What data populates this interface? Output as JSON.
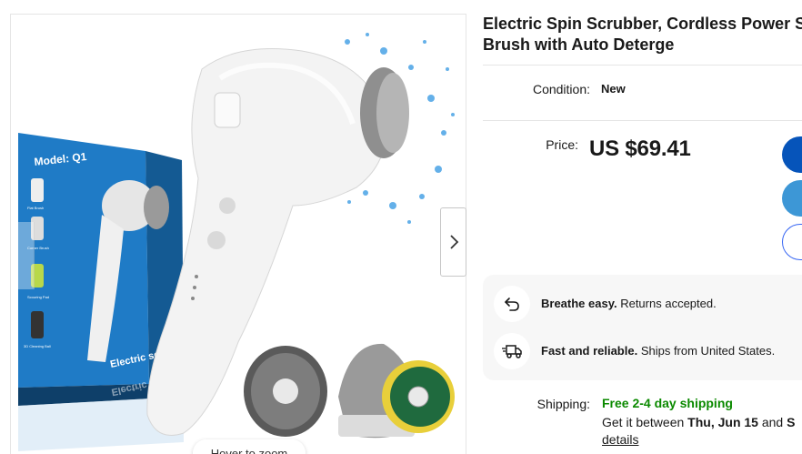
{
  "listing": {
    "title_line1": "Electric Spin Scrubber, Cordless Power S",
    "title_line2": "Brush with Auto Deterge"
  },
  "image": {
    "zoom_hint": "Hover to zoom",
    "box_model_text": "Model: Q1",
    "box_side_text": "Electric scrub",
    "box_side_reflection": "Electric scrub",
    "heads": [
      "Flat Brush",
      "Corner Brush",
      "Scouring Pad",
      "3D Cleaning Ball"
    ]
  },
  "condition": {
    "label": "Condition:",
    "value": "New"
  },
  "price": {
    "label": "Price:",
    "value": "US $69.41"
  },
  "assurances": [
    {
      "icon": "return-arrow-icon",
      "bold": "Breathe easy.",
      "text": " Returns accepted."
    },
    {
      "icon": "delivery-truck-icon",
      "bold": "Fast and reliable.",
      "text": " Ships from United States."
    }
  ],
  "shipping": {
    "label": "Shipping:",
    "free": "Free 2-4 day shipping",
    "est_prefix": "Get it between ",
    "est_date": "Thu, Jun 15",
    "est_and": " and ",
    "est_end": "S",
    "details": "details"
  },
  "colors": {
    "buy_now": "#0654ba",
    "add_to_cart": "#3d97d6",
    "watch_border": "#3665f3",
    "free_shipping": "#0b8a00",
    "box_blue": "#1f7bc6"
  }
}
